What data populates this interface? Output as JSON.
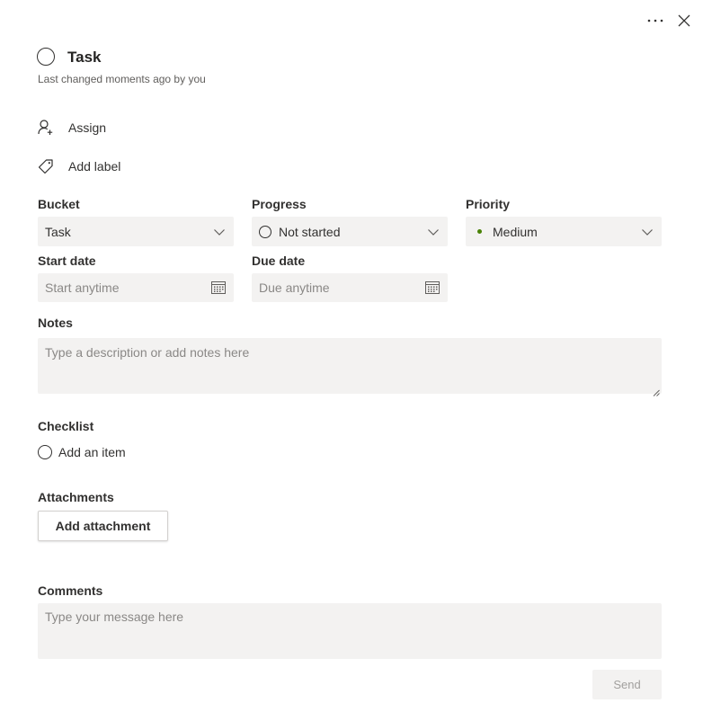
{
  "header": {
    "title": "Task",
    "last_changed": "Last changed moments ago by you",
    "more_icon": "more-ellipsis-icon",
    "close_icon": "close-icon"
  },
  "actions": {
    "assign_label": "Assign",
    "add_label_label": "Add label"
  },
  "fields": {
    "bucket": {
      "label": "Bucket",
      "value": "Task"
    },
    "progress": {
      "label": "Progress",
      "value": "Not started"
    },
    "priority": {
      "label": "Priority",
      "value": "Medium",
      "dot_color": "#498205"
    },
    "start_date": {
      "label": "Start date",
      "placeholder": "Start anytime"
    },
    "due_date": {
      "label": "Due date",
      "placeholder": "Due anytime"
    }
  },
  "notes": {
    "label": "Notes",
    "placeholder": "Type a description or add notes here"
  },
  "checklist": {
    "label": "Checklist",
    "add_item": "Add an item"
  },
  "attachments": {
    "label": "Attachments",
    "button": "Add attachment"
  },
  "comments": {
    "label": "Comments",
    "placeholder": "Type your message here",
    "send": "Send"
  }
}
